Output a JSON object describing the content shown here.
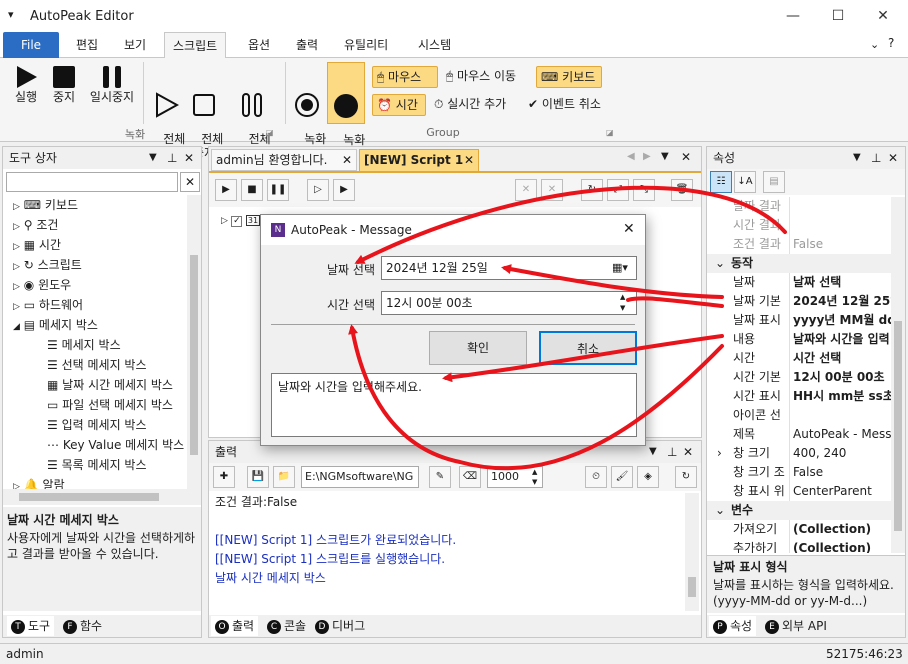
{
  "window": {
    "title": "AutoPeak Editor"
  },
  "menu": [
    "File",
    "편집",
    "보기",
    "스크립트",
    "옵션",
    "출력",
    "유틸리티",
    "시스템"
  ],
  "ribbon": {
    "run": "실행",
    "stop": "중지",
    "pause": "일시중지",
    "run_all": "전체\n실행",
    "stop_all": "전체\n중지",
    "pause_all": "전체\n일시중지",
    "rec_start": "녹화\n시작",
    "rec_stop": "녹화\n중지",
    "group_rec": "녹화",
    "group_group": "Group",
    "mouse": "마우스",
    "mouse_move": "마우스 이동",
    "keyboard": "키보드",
    "time": "시간",
    "realtime_add": "실시간 추가",
    "event_cancel": "이벤트 취소"
  },
  "toolbox": {
    "title": "도구 상자",
    "items": [
      "키보드",
      "조건",
      "시간",
      "스크립트",
      "윈도우",
      "하드웨어",
      "메세지 박스",
      "메세지 박스",
      "선택 메세지 박스",
      "날짜 시간 메세지 박스",
      "파일 선택 메세지 박스",
      "입력 메세지 박스",
      "Key Value 메세지 박스",
      "목록 메세지 박스",
      "알람"
    ],
    "desc_title": "날짜 시간 메세지 박스",
    "desc_text": "사용자에게 날짜와 시간을 선택하게하고 결과를 받아올 수 있습니다.",
    "tabs": [
      "도구",
      "함수"
    ]
  },
  "tabs": [
    "admin님 환영합니다.",
    "[NEW] Script 1"
  ],
  "tree_root": "31",
  "dialog": {
    "title": "AutoPeak - Message",
    "date_label": "날짜 선택",
    "date_value": "2024년 12월 25일",
    "time_label": "시간 선택",
    "time_value": "12시 00분 00초",
    "ok": "확인",
    "cancel": "취소",
    "message": "날짜와 시간을 입력해주세요."
  },
  "output": {
    "title": "출력",
    "path": "E:\\NGMsoftware\\NG",
    "count": "1000",
    "lines": [
      "조건 결과:False",
      "",
      "[[NEW] Script 1] 스크립트가 완료되었습니다.",
      "[[NEW] Script 1] 스크립트를 실행했습니다.",
      "날짜 시간 메세지 박스"
    ],
    "tabs": [
      "출력",
      "콘솔",
      "디버그"
    ]
  },
  "props": {
    "title": "속성",
    "rows": [
      {
        "k": "날짜 결과",
        "v": "",
        "dim": true
      },
      {
        "k": "시간 결과",
        "v": "",
        "dim": true
      },
      {
        "k": "조건 결과",
        "v": "False",
        "dim": true
      },
      {
        "k": "동작",
        "v": "",
        "cat": true
      },
      {
        "k": "날짜",
        "v": "날짜 선택",
        "bold": true
      },
      {
        "k": "날짜 기본",
        "v": "2024년 12월 25일",
        "bold": true
      },
      {
        "k": "날짜 표시",
        "v": "yyyy년 MM월 dd",
        "bold": true
      },
      {
        "k": "내용",
        "v": "날짜와 시간을 입력",
        "bold": true
      },
      {
        "k": "시간",
        "v": "시간 선택",
        "bold": true
      },
      {
        "k": "시간 기본",
        "v": "12시 00분 00초",
        "bold": true
      },
      {
        "k": "시간 표시",
        "v": "HH시 mm분 ss초",
        "bold": true
      },
      {
        "k": "아이콘 선",
        "v": ""
      },
      {
        "k": "제목",
        "v": "AutoPeak - Messa"
      },
      {
        "k": "창 크기",
        "v": "400, 240",
        "exp": true
      },
      {
        "k": "창 크기 조",
        "v": "False"
      },
      {
        "k": "창 표시 위",
        "v": "CenterParent"
      },
      {
        "k": "변수",
        "v": "",
        "cat": true
      },
      {
        "k": "가져오기",
        "v": "(Collection)",
        "bold": true
      },
      {
        "k": "추가하기",
        "v": "(Collection)",
        "bold": true
      }
    ],
    "desc_title": "날짜 표시 형식",
    "desc_text": "날짜를 표시하는 형식을 입력하세요. (yyyy-MM-dd or yy-M-d...)",
    "tabs": [
      "속성",
      "외부 API"
    ]
  },
  "status": {
    "user": "admin",
    "time": "52175:46:23"
  },
  "colors": {
    "accent": "#2b6cc4",
    "arrow": "#e8141c",
    "highlight": "#fcd983"
  }
}
